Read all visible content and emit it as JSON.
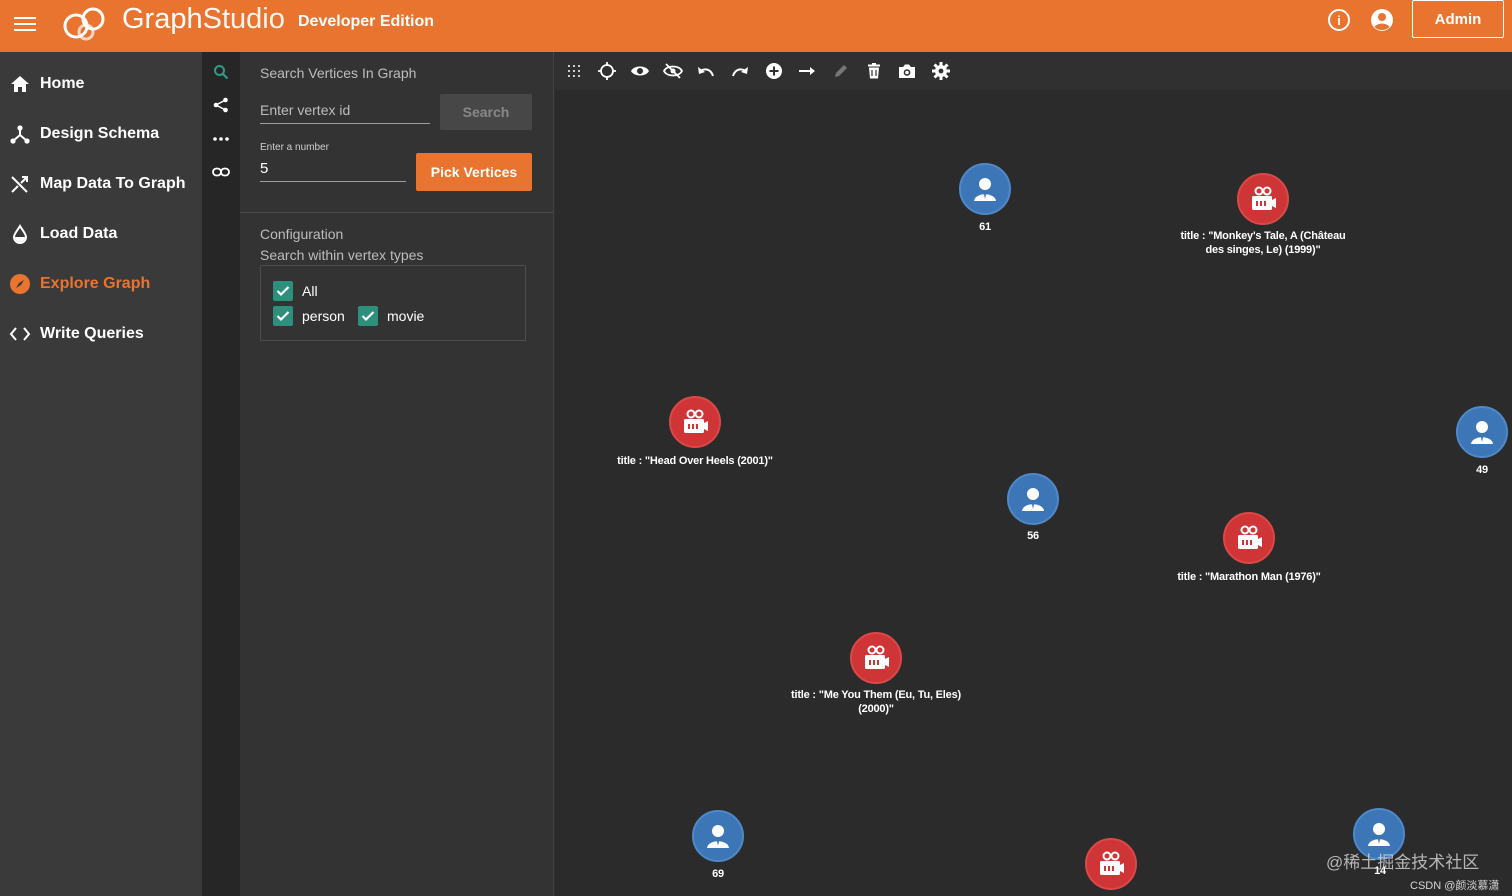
{
  "header": {
    "brand_graph": "Graph",
    "brand_studio": "Studio",
    "edition": "Developer Edition",
    "info_glyph": "i",
    "admin_label": "Admin",
    "accent_color": "#e8742f"
  },
  "sidebar": {
    "items": [
      {
        "label": "Home",
        "icon": "home-icon"
      },
      {
        "label": "Design Schema",
        "icon": "schema-icon"
      },
      {
        "label": "Map Data To Graph",
        "icon": "shuffle-icon"
      },
      {
        "label": "Load Data",
        "icon": "drop-icon"
      },
      {
        "label": "Explore Graph",
        "icon": "compass-icon",
        "active": true
      },
      {
        "label": "Write Queries",
        "icon": "code-icon"
      }
    ]
  },
  "rail": {
    "icons": [
      "search-icon",
      "share-icon",
      "more-horizontal-icon",
      "link-icon"
    ]
  },
  "search_panel": {
    "title": "Search Vertices In Graph",
    "vertex_placeholder": "Enter vertex id",
    "search_label": "Search",
    "number_label": "Enter a number",
    "number_value": "5",
    "pick_label": "Pick Vertices",
    "config_title": "Configuration",
    "config_subtitle": "Search within vertex types",
    "checkboxes": [
      {
        "label": "All",
        "checked": true
      },
      {
        "label": "person",
        "checked": true
      },
      {
        "label": "movie",
        "checked": true
      }
    ]
  },
  "toolbar": {
    "icons": [
      "grid-icon",
      "locate-icon",
      "show-icon",
      "hide-icon",
      "undo-icon",
      "redo-icon",
      "add-vertex-icon",
      "add-edge-icon",
      "edit-icon",
      "delete-icon",
      "screenshot-icon",
      "settings-icon"
    ]
  },
  "graph": {
    "person_color": "#3d76b7",
    "movie_color": "#cf3536",
    "nodes": [
      {
        "type": "person",
        "label": "61"
      },
      {
        "type": "movie",
        "label": "title : \"Monkey's Tale, A (Château des singes, Le) (1999)\""
      },
      {
        "type": "movie",
        "label": "title : \"Head Over Heels (2001)\""
      },
      {
        "type": "person",
        "label": "49"
      },
      {
        "type": "person",
        "label": "56"
      },
      {
        "type": "movie",
        "label": "title : \"Marathon Man (1976)\""
      },
      {
        "type": "movie",
        "label": "title : \"Me You Them (Eu, Tu, Eles) (2000)\""
      },
      {
        "type": "person",
        "label": "69"
      },
      {
        "type": "movie",
        "label": ""
      },
      {
        "type": "person",
        "label": "14"
      }
    ]
  },
  "watermark": "@稀土掘金技术社区",
  "credit": "CSDN @颜淡慕潇"
}
